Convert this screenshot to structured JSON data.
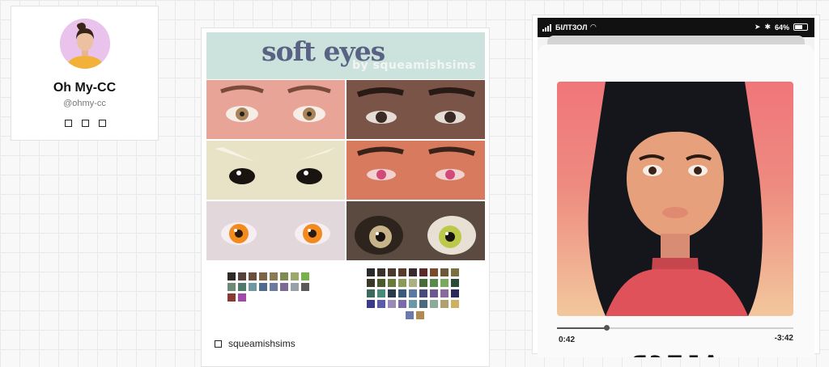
{
  "profile": {
    "name": "Oh My-CC",
    "handle": "@ohmy-cc",
    "social_icons": [
      "social-link-icon",
      "social-link-icon",
      "social-link-icon"
    ]
  },
  "post_soft_eyes": {
    "banner_title": "soft eyes",
    "banner_subtitle": "by squeamishsims",
    "creator": "squeamishsims",
    "swatches_left": [
      "#2f2a2a",
      "#54423a",
      "#6b4d3c",
      "#7d6447",
      "#8b7a52",
      "#7d8a52",
      "#9aa86a",
      "#7ab04c",
      "#6d8b74",
      "#4f7a6a",
      "#6e98a0",
      "#4e6a8c",
      "#6a7aa0",
      "#7b6a94",
      "#9aa0a8",
      "#5a5a5a",
      "#8b3a32",
      "#a04aa8"
    ],
    "swatches_right": [
      "#2a2a2a",
      "#3a302a",
      "#4a3a2e",
      "#5a3a2a",
      "#3a2a30",
      "#5a2a2a",
      "#7a4a2a",
      "#6a5a3a",
      "#7a7040",
      "#3a3a24",
      "#4a5a2a",
      "#6a7a3a",
      "#8a9a5a",
      "#aab080",
      "#4a6a3a",
      "#5a8a4a",
      "#7aaa60",
      "#2a4a3a",
      "#3a6a5a",
      "#4a8a7a",
      "#2a3a4a",
      "#3a5a7a",
      "#5a7aa0",
      "#4a4a7a",
      "#6a5a90",
      "#8a6a9a",
      "#2a2a5a",
      "#3a3a8a",
      "#5a5aaa",
      "#9a8aba",
      "#7a6aaa",
      "#6a9aaa",
      "#4a6a80",
      "#8aaa9a",
      "#b0a070",
      "#d0b060"
    ],
    "swatches_right_extra": [
      "#6a7ab0",
      "#b08a50"
    ]
  },
  "post_phone": {
    "status": {
      "carrier": "БІЛТЗОЛ",
      "battery": "64%"
    },
    "elapsed": "0:42",
    "remaining": "-3:42",
    "progress": 0.21,
    "title": "ЯЭTJA"
  }
}
